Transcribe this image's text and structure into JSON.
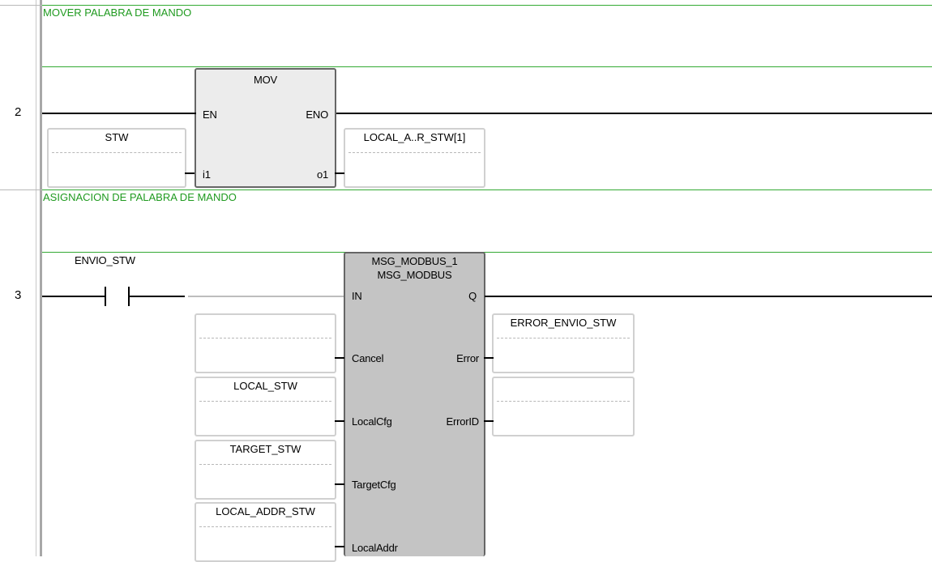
{
  "rungs": [
    {
      "number": "2",
      "comment": "MOVER PALABRA DE MANDO",
      "block": {
        "name": "MOV",
        "inputs": [
          "EN",
          "i1"
        ],
        "outputs": [
          "ENO",
          "o1"
        ]
      },
      "input_vars": [
        "STW"
      ],
      "output_vars": [
        "LOCAL_A..R_STW[1]"
      ]
    },
    {
      "number": "3",
      "comment": "ASIGNACION DE PALABRA DE MANDO",
      "contact": {
        "label": "ENVIO_STW"
      },
      "block": {
        "instance": "MSG_MODBUS_1",
        "type": "MSG_MODBUS",
        "inputs": [
          "IN",
          "Cancel",
          "LocalCfg",
          "TargetCfg",
          "LocalAddr"
        ],
        "outputs": [
          "Q",
          "Error",
          "ErrorID"
        ]
      },
      "input_vars": [
        "",
        "LOCAL_STW",
        "TARGET_STW",
        "LOCAL_ADDR_STW"
      ],
      "output_vars": [
        "ERROR_ENVIO_STW",
        ""
      ]
    }
  ]
}
